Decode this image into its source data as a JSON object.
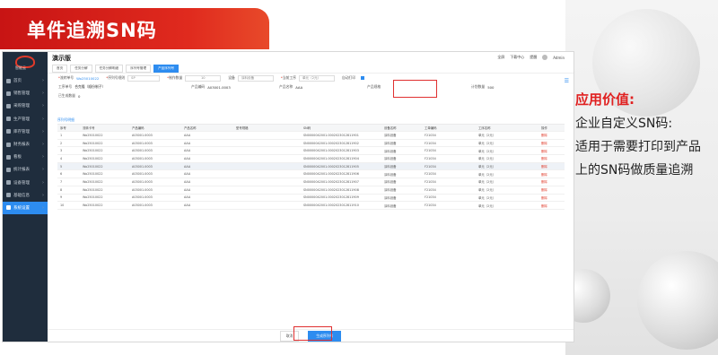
{
  "slide": {
    "title": "单件追溯SN码",
    "value_heading": "应用价值:",
    "value_lines": [
      "企业自定义SN码:",
      "适用于需要打印到产品",
      "上的SN码做质量追溯"
    ]
  },
  "app": {
    "logo_text": "智能云",
    "title": "演示版",
    "top_actions": [
      "全屏",
      "下载中心",
      "提醒",
      "Admin"
    ],
    "nav": [
      {
        "label": "首页",
        "active": false
      },
      {
        "label": "销售管理",
        "active": false
      },
      {
        "label": "采购管理",
        "active": false
      },
      {
        "label": "生产管理",
        "active": false
      },
      {
        "label": "库存管理",
        "active": false
      },
      {
        "label": "财务报表",
        "active": false
      },
      {
        "label": "看板",
        "active": false
      },
      {
        "label": "统计报表",
        "active": false
      },
      {
        "label": "设备管理",
        "active": false
      },
      {
        "label": "基础信息",
        "active": false
      },
      {
        "label": "系统设置",
        "active": true
      }
    ],
    "tabs": [
      "首页",
      "任务分解",
      "任务分解明细",
      "序列号管理",
      "产品序列号"
    ],
    "form": {
      "order_label": "流转单号",
      "order_value": "Wo25010022",
      "rule_label": "序列号规则",
      "rule_value": "SP",
      "count_label": "制作数量",
      "count_value": "10",
      "device_label": "设备",
      "device_value": "涂料设备",
      "process_label": "当前工序",
      "process_value": "单元（2元）",
      "auto_print_label": "自动打印",
      "process_order_label": "工序单号",
      "process_order_value": "合克隆（顺份制子）",
      "product_code_label": "产品编码",
      "product_code_value": "A03001.0003",
      "product_name_label": "产品名称",
      "product_name_value": "AAA",
      "spec_label": "产品规格",
      "spec_value": "",
      "plan_label": "计划数量",
      "plan_value": "500",
      "done_label": "已生成数量",
      "done_value": "0"
    },
    "subtab": "序列号明细",
    "table": {
      "headers": [
        "序号",
        "流转卡号",
        "产品编码",
        "产品名称",
        "型号规格",
        "SN码",
        "设备名称",
        "工单编码",
        "工序名称",
        "操作"
      ],
      "rows": [
        [
          "1",
          "Wo25010022",
          "A03001.0003",
          "AAA",
          "",
          "SN0000042001.0002023012811901",
          "涂料设备",
          "F21034",
          "单元（2元）",
          "删除"
        ],
        [
          "2",
          "Wo25010022",
          "A03001.0003",
          "AAA",
          "",
          "SN0000042001.0002023012811902",
          "涂料设备",
          "F21034",
          "单元（2元）",
          "删除"
        ],
        [
          "3",
          "Wo25010022",
          "A03001.0003",
          "AAA",
          "",
          "SN0000042001.0002023012811903",
          "涂料设备",
          "F21034",
          "单元（2元）",
          "删除"
        ],
        [
          "4",
          "Wo25010022",
          "A03001.0003",
          "AAA",
          "",
          "SN0000042001.0002023012811904",
          "涂料设备",
          "F21034",
          "单元（2元）",
          "删除"
        ],
        [
          "5",
          "Wo25010022",
          "A03001.0003",
          "AAA",
          "",
          "SN0000042001.0002023012811905",
          "涂料设备",
          "F21034",
          "单元（2元）",
          "删除"
        ],
        [
          "6",
          "Wo25010022",
          "A03001.0003",
          "AAA",
          "",
          "SN0000042001.0002023012811906",
          "涂料设备",
          "F21034",
          "单元（2元）",
          "删除"
        ],
        [
          "7",
          "Wo25010022",
          "A03001.0003",
          "AAA",
          "",
          "SN0000042001.0002023012811907",
          "涂料设备",
          "F21034",
          "单元（2元）",
          "删除"
        ],
        [
          "8",
          "Wo25010022",
          "A03001.0003",
          "AAA",
          "",
          "SN0000042001.0002023012811908",
          "涂料设备",
          "F21034",
          "单元（2元）",
          "删除"
        ],
        [
          "9",
          "Wo25010022",
          "A03001.0003",
          "AAA",
          "",
          "SN0000042001.0002023012811909",
          "涂料设备",
          "F21034",
          "单元（2元）",
          "删除"
        ],
        [
          "10",
          "Wo25010022",
          "A03001.0003",
          "AAA",
          "",
          "SN0000042001.0002023012811910",
          "涂料设备",
          "F21034",
          "单元（2元）",
          "删除"
        ]
      ]
    },
    "footer": {
      "cancel": "取消",
      "generate": "生成序列号"
    }
  }
}
